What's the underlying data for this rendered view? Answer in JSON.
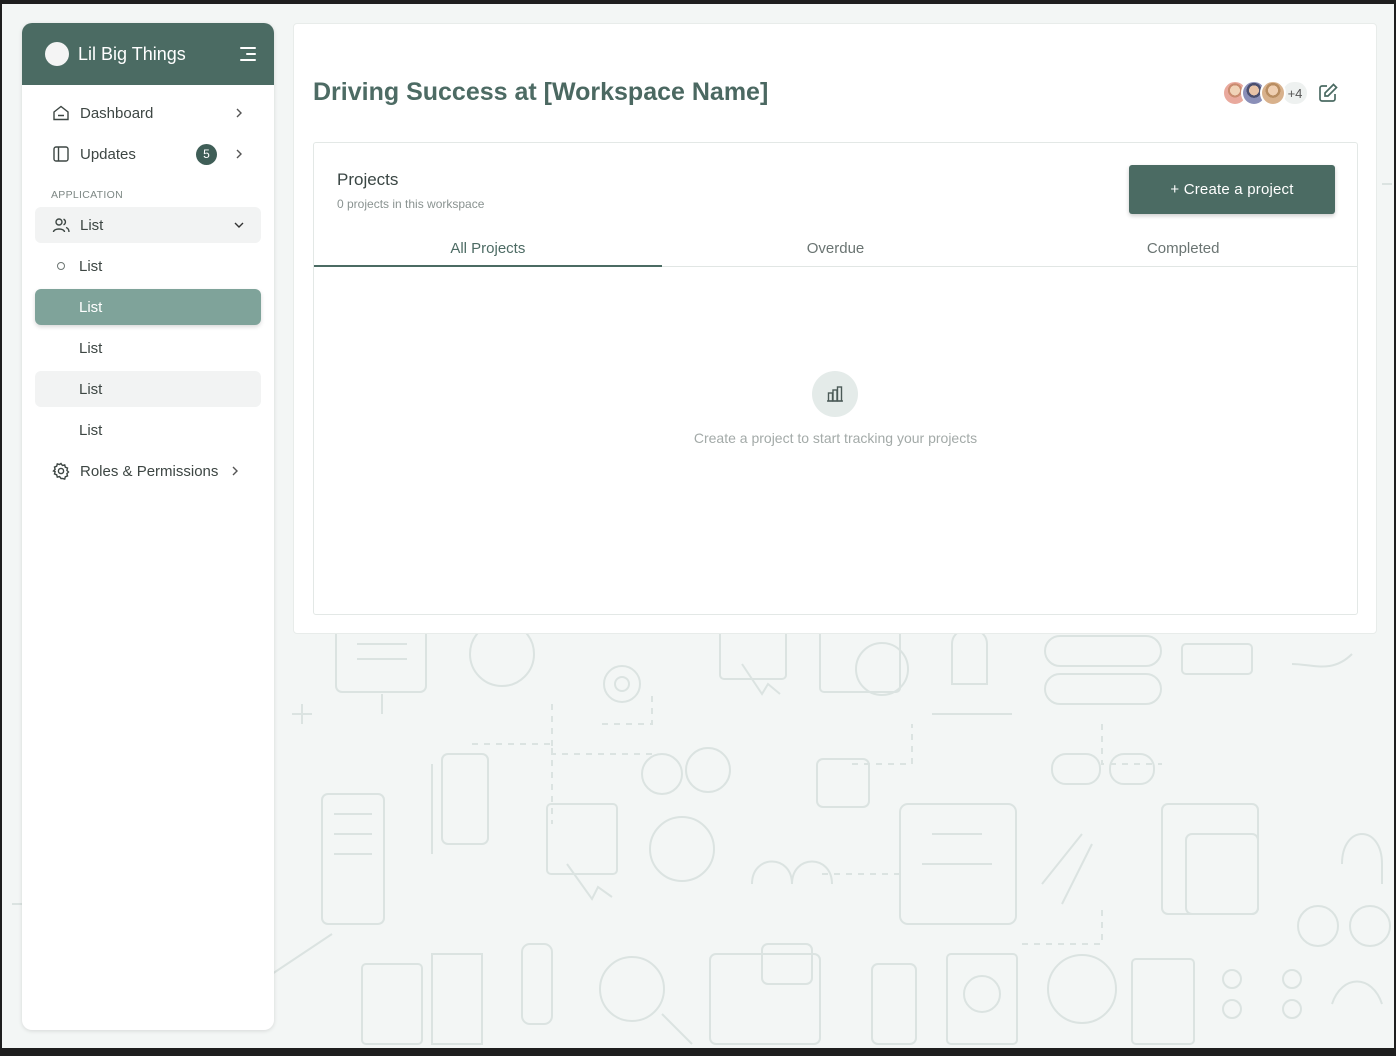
{
  "app": {
    "name": "Lil Big Things"
  },
  "sidebar": {
    "items": [
      {
        "label": "Dashboard"
      },
      {
        "label": "Updates",
        "badge": "5"
      }
    ],
    "section_label": "APPLICATION",
    "group": {
      "label": "List"
    },
    "subitems": [
      {
        "label": "List",
        "state": "default"
      },
      {
        "label": "List",
        "state": "active"
      },
      {
        "label": "List",
        "state": "default"
      },
      {
        "label": "List",
        "state": "hover"
      },
      {
        "label": "List",
        "state": "default"
      }
    ],
    "roles": {
      "label": "Roles & Permissions"
    }
  },
  "main": {
    "title_prefix": "Driving Success at ",
    "title_bold": "[Workspace Name]",
    "avatars": {
      "more": "+4"
    },
    "projects": {
      "title": "Projects",
      "subtitle": "0 projects in this workspace",
      "create_label": "+ Create a project",
      "tabs": [
        "All Projects",
        "Overdue",
        "Completed"
      ],
      "active_tab": "All Projects",
      "empty_text": "Create a project to start tracking your projects"
    }
  },
  "colors": {
    "brand": "#4b6b63",
    "active_item": "#7fa39a",
    "background": "#f3f6f5"
  },
  "icons": [
    "menu-icon",
    "home-icon",
    "sidebar-panel-icon",
    "users-icon",
    "gear-icon",
    "chevron-right-icon",
    "chevron-down-icon",
    "edit-icon",
    "chart-icon"
  ]
}
